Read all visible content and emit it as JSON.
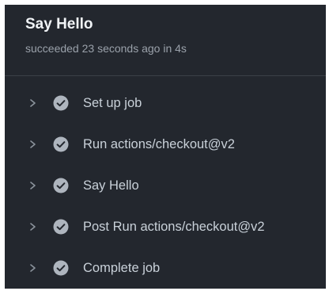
{
  "job": {
    "title": "Say Hello",
    "status": "succeeded 23 seconds ago in 4s"
  },
  "steps": [
    {
      "label": "Set up job",
      "icon": "check-circle-icon",
      "expander": "chevron-right-icon"
    },
    {
      "label": "Run actions/checkout@v2",
      "icon": "check-circle-icon",
      "expander": "chevron-right-icon"
    },
    {
      "label": "Say Hello",
      "icon": "check-circle-icon",
      "expander": "chevron-right-icon"
    },
    {
      "label": "Post Run actions/checkout@v2",
      "icon": "check-circle-icon",
      "expander": "chevron-right-icon"
    },
    {
      "label": "Complete job",
      "icon": "check-circle-icon",
      "expander": "chevron-right-icon"
    }
  ],
  "colors": {
    "panel_background": "#23272e",
    "divider": "#3b4048",
    "title_text": "#f0f3f6",
    "muted_text": "#9aa1aa",
    "step_text": "#c9d1d9",
    "check_circle": "#aeb5be"
  }
}
